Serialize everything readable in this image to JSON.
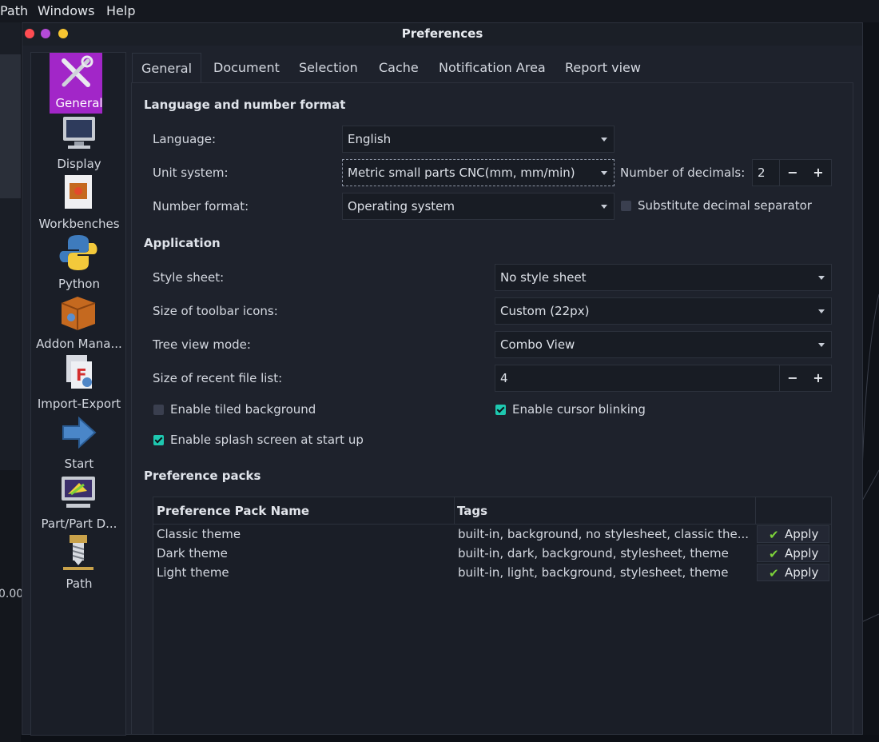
{
  "menubar": {
    "path": "Path",
    "windows": "Windows",
    "help": "Help"
  },
  "host": {
    "number": "0.00"
  },
  "dialog": {
    "title": "Preferences"
  },
  "categories": [
    {
      "label": "General",
      "icon": "wrench-screwdriver-icon",
      "selected": true
    },
    {
      "label": "Display",
      "icon": "monitor-icon"
    },
    {
      "label": "Workbenches",
      "icon": "workbench-box-icon"
    },
    {
      "label": "Python",
      "icon": "python-icon"
    },
    {
      "label": "Addon Mana...",
      "icon": "addon-box-icon"
    },
    {
      "label": "Import-Export",
      "icon": "import-export-icon"
    },
    {
      "label": "Start",
      "icon": "arrow-right-icon"
    },
    {
      "label": "Part/Part D...",
      "icon": "part-design-icon"
    },
    {
      "label": "Path",
      "icon": "drill-icon"
    }
  ],
  "tabs": [
    "General",
    "Document",
    "Selection",
    "Cache",
    "Notification Area",
    "Report view"
  ],
  "language_section": {
    "heading": "Language and number format",
    "language_label": "Language:",
    "language_value": "English",
    "unit_label": "Unit system:",
    "unit_value": "Metric small parts  CNC(mm, mm/min)",
    "decimals_label": "Number of decimals:",
    "decimals_value": "2",
    "format_label": "Number format:",
    "format_value": "Operating system",
    "substitute_label": "Substitute decimal separator"
  },
  "application_section": {
    "heading": "Application",
    "stylesheet_label": "Style sheet:",
    "stylesheet_value": "No style sheet",
    "iconsize_label": "Size of toolbar icons:",
    "iconsize_value": "Custom (22px)",
    "treeview_label": "Tree view mode:",
    "treeview_value": "Combo View",
    "recent_label": "Size of recent file list:",
    "recent_value": "4",
    "tiled_label": "Enable tiled background",
    "blink_label": "Enable cursor blinking",
    "splash_label": "Enable splash screen at start up"
  },
  "spin": {
    "minus": "−",
    "plus": "+"
  },
  "packs": {
    "heading": "Preference packs",
    "col_name": "Preference Pack Name",
    "col_tags": "Tags",
    "apply_label": "Apply",
    "rows": [
      {
        "name": "Classic theme",
        "tags": "built-in, background, no stylesheet, classic the..."
      },
      {
        "name": "Dark theme",
        "tags": "built-in, dark, background, stylesheet, theme"
      },
      {
        "name": "Light theme",
        "tags": "built-in, light, background, stylesheet, theme"
      }
    ]
  },
  "colors": {
    "accent": "#a226c8",
    "check": "#1ec8b0",
    "apply_check": "#7cd13a"
  }
}
